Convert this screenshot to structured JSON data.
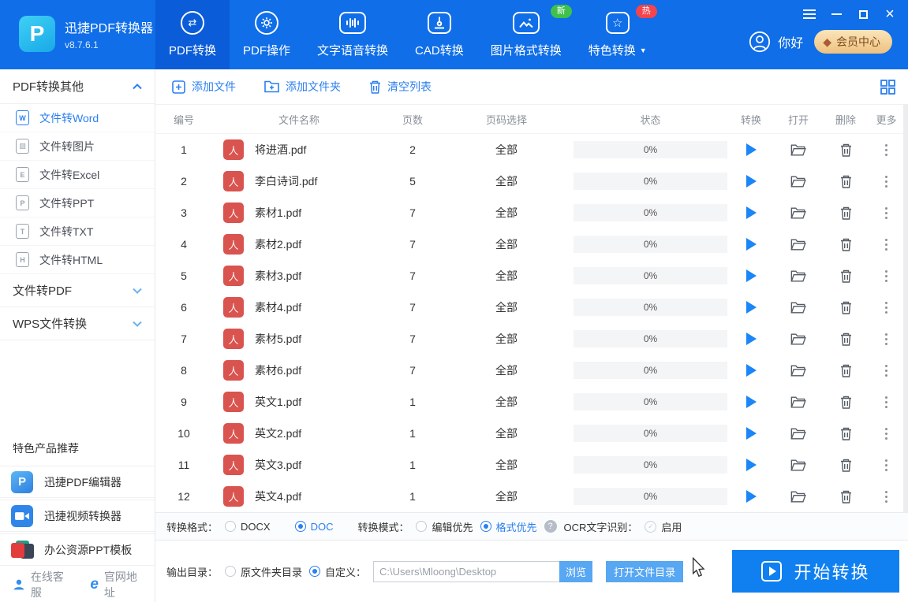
{
  "app": {
    "name": "迅捷PDF转换器",
    "version": "v8.7.6.1",
    "logo_letter": "P"
  },
  "icons": {
    "close": "×",
    "swap_arrows": "⇄",
    "star": "☆",
    "vip_diamond": "◆",
    "check": "✓",
    "help": "?",
    "caret_down": "▼",
    "pdf_glyph": "人",
    "ie_e": "e"
  },
  "nav": {
    "items": [
      {
        "label": "PDF转换",
        "active": true
      },
      {
        "label": "PDF操作",
        "active": false
      },
      {
        "label": "文字语音转换",
        "active": false
      },
      {
        "label": "CAD转换",
        "active": false
      },
      {
        "label": "图片格式转换",
        "active": false,
        "badge": "新"
      },
      {
        "label": "特色转换",
        "active": false,
        "badge": "热"
      }
    ]
  },
  "header_right": {
    "greeting": "你好",
    "vip": "会员中心"
  },
  "sidebar": {
    "groups": [
      {
        "label": "PDF转换其他",
        "expanded": true
      },
      {
        "label": "文件转PDF",
        "expanded": false
      },
      {
        "label": "WPS文件转换",
        "expanded": false
      }
    ],
    "items": [
      {
        "label": "文件转Word",
        "glyph": "W",
        "active": true
      },
      {
        "label": "文件转图片",
        "glyph": "▨",
        "active": false
      },
      {
        "label": "文件转Excel",
        "glyph": "E",
        "active": false
      },
      {
        "label": "文件转PPT",
        "glyph": "P",
        "active": false
      },
      {
        "label": "文件转TXT",
        "glyph": "T",
        "active": false
      },
      {
        "label": "文件转HTML",
        "glyph": "H",
        "active": false
      }
    ],
    "promo_heading": "特色产品推荐",
    "products": [
      {
        "label": "迅捷PDF编辑器",
        "glyph": "P"
      },
      {
        "label": "迅捷视频转换器"
      },
      {
        "label": "办公资源PPT模板"
      }
    ],
    "footer": {
      "support": "在线客服",
      "website": "官网地址"
    }
  },
  "toolbar": {
    "add_file": "添加文件",
    "add_folder": "添加文件夹",
    "clear_list": "清空列表"
  },
  "table": {
    "headers": {
      "no": "编号",
      "name": "文件名称",
      "pages": "页数",
      "range": "页码选择",
      "status": "状态",
      "convert": "转换",
      "open": "打开",
      "delete": "删除",
      "more": "更多"
    },
    "rows": [
      {
        "no": "1",
        "name": "将进酒.pdf",
        "pages": "2",
        "range": "全部",
        "progress": "0%"
      },
      {
        "no": "2",
        "name": "李白诗词.pdf",
        "pages": "5",
        "range": "全部",
        "progress": "0%"
      },
      {
        "no": "3",
        "name": "素材1.pdf",
        "pages": "7",
        "range": "全部",
        "progress": "0%"
      },
      {
        "no": "4",
        "name": "素材2.pdf",
        "pages": "7",
        "range": "全部",
        "progress": "0%"
      },
      {
        "no": "5",
        "name": "素材3.pdf",
        "pages": "7",
        "range": "全部",
        "progress": "0%"
      },
      {
        "no": "6",
        "name": "素材4.pdf",
        "pages": "7",
        "range": "全部",
        "progress": "0%"
      },
      {
        "no": "7",
        "name": "素材5.pdf",
        "pages": "7",
        "range": "全部",
        "progress": "0%"
      },
      {
        "no": "8",
        "name": "素材6.pdf",
        "pages": "7",
        "range": "全部",
        "progress": "0%"
      },
      {
        "no": "9",
        "name": "英文1.pdf",
        "pages": "1",
        "range": "全部",
        "progress": "0%"
      },
      {
        "no": "10",
        "name": "英文2.pdf",
        "pages": "1",
        "range": "全部",
        "progress": "0%"
      },
      {
        "no": "11",
        "name": "英文3.pdf",
        "pages": "1",
        "range": "全部",
        "progress": "0%"
      },
      {
        "no": "12",
        "name": "英文4.pdf",
        "pages": "1",
        "range": "全部",
        "progress": "0%"
      }
    ]
  },
  "settings": {
    "format_label": "转换格式：",
    "format_docx": "DOCX",
    "format_doc": "DOC",
    "mode_label": "转换模式：",
    "mode_edit": "编辑优先",
    "mode_format": "格式优先",
    "ocr_label": "OCR文字识别：",
    "ocr_enable": "启用"
  },
  "output": {
    "label": "输出目录：",
    "opt_original": "原文件夹目录",
    "opt_custom": "自定义：",
    "path": "C:\\Users\\Mloong\\Desktop",
    "browse": "浏览",
    "open_dir": "打开文件目录",
    "start": "开始转换"
  },
  "colors": {
    "header_blue": "#0f6ee8",
    "active_tab_blue": "#0a5cd8",
    "accent_blue": "#2b7ff0",
    "start_button_blue": "#1080f0",
    "light_button_blue": "#57a7f2",
    "pdf_icon_red": "#d9534f",
    "badge_new_green": "#3fc14c",
    "badge_hot_red": "#f4444e",
    "vip_gold": "#eec180"
  }
}
